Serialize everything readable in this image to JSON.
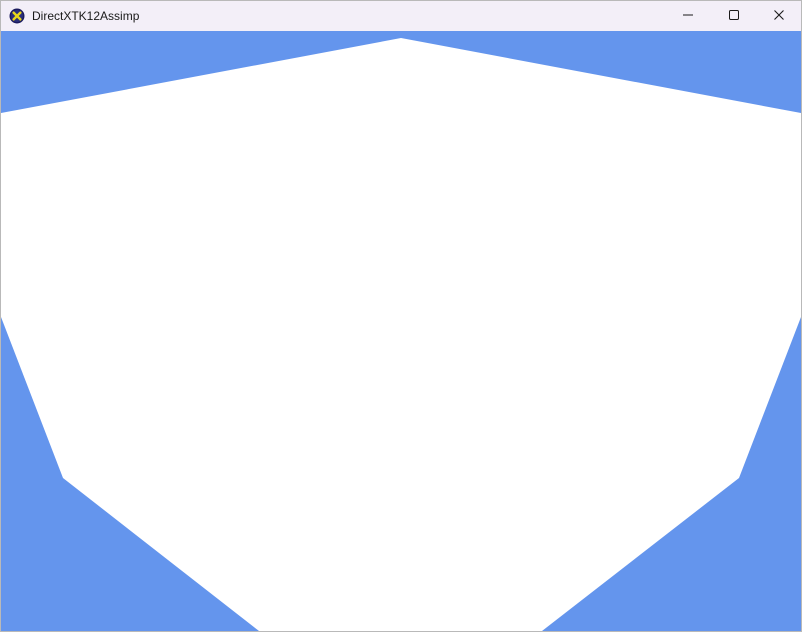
{
  "window": {
    "title": "DirectXTK12Assimp",
    "app_icon": "directx-icon",
    "controls": {
      "minimize_icon": "minimize-icon",
      "maximize_icon": "maximize-icon",
      "close_icon": "close-icon"
    }
  },
  "render": {
    "clear_color": "#6495ed",
    "mesh_color": "#ffffff"
  }
}
